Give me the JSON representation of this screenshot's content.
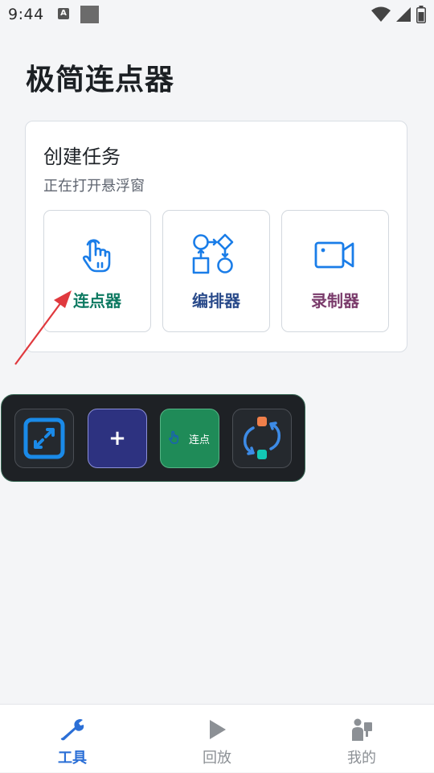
{
  "status_bar": {
    "time": "9:44",
    "app_icon_letter": "A",
    "icons": [
      "wifi-icon",
      "signal-icon",
      "battery-icon"
    ]
  },
  "header": {
    "title": "极简连点器"
  },
  "create_task": {
    "title": "创建任务",
    "subtitle": "正在打开悬浮窗",
    "tools": [
      {
        "label": "连点器",
        "icon": "tap-hand-icon",
        "color": "#0e7a62"
      },
      {
        "label": "编排器",
        "icon": "flowchart-icon",
        "color": "#294a8a"
      },
      {
        "label": "录制器",
        "icon": "video-camera-icon",
        "color": "#7a3b6b"
      }
    ]
  },
  "floating_bar": {
    "buttons": [
      {
        "name": "resize",
        "icon": "resize-icon"
      },
      {
        "name": "add",
        "label": "+"
      },
      {
        "name": "clicker",
        "label": "连点",
        "icon": "tap-hand-icon"
      },
      {
        "name": "sync",
        "icon": "sync-icon"
      }
    ]
  },
  "bottom_nav": {
    "items": [
      {
        "label": "工具",
        "icon": "wrench-icon",
        "active": true
      },
      {
        "label": "回放",
        "icon": "play-icon",
        "active": false
      },
      {
        "label": "我的",
        "icon": "person-icon",
        "active": false
      }
    ],
    "active_color": "#2b6fd6",
    "inactive_color": "#8c9095"
  },
  "colors": {
    "background": "#f4f5f7",
    "icon_blue": "#1a7de8",
    "arrow_red": "#e0393e"
  }
}
